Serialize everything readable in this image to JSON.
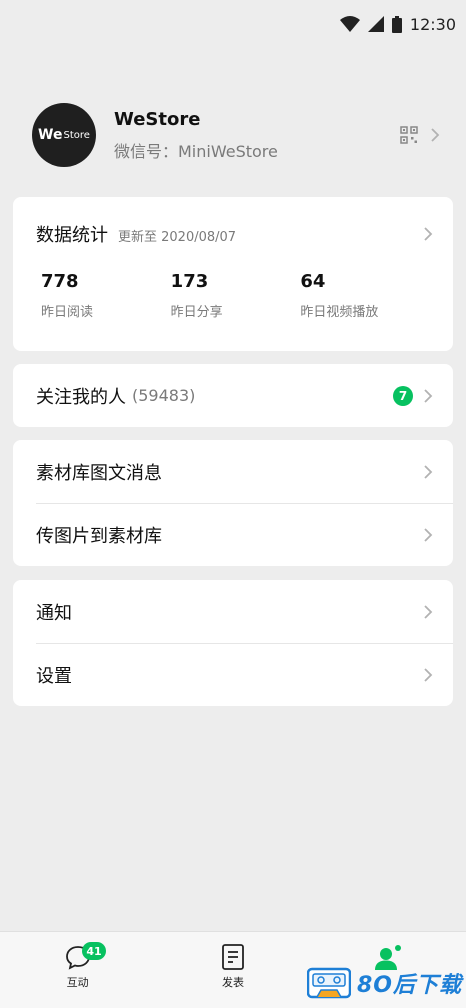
{
  "status_bar": {
    "time": "12:30"
  },
  "profile": {
    "avatar_text_we": "We",
    "avatar_text_store": "Store",
    "name": "WeStore",
    "wechat_id": "微信号：MiniWeStore"
  },
  "stats": {
    "title": "数据统计",
    "updated": "更新至 2020/08/07",
    "items": [
      {
        "value": "778",
        "label": "昨日阅读"
      },
      {
        "value": "173",
        "label": "昨日分享"
      },
      {
        "value": "64",
        "label": "昨日视频播放"
      }
    ]
  },
  "followers": {
    "label": "关注我的人",
    "count": "(59483)",
    "badge": "7"
  },
  "materials": {
    "items": [
      {
        "label": "素材库图文消息"
      },
      {
        "label": "传图片到素材库"
      }
    ]
  },
  "settings": {
    "items": [
      {
        "label": "通知"
      },
      {
        "label": "设置"
      }
    ]
  },
  "tabbar": {
    "tabs": [
      {
        "label": "互动",
        "badge": "41"
      },
      {
        "label": "发表"
      },
      {
        "label": "我"
      }
    ]
  },
  "watermark": {
    "text": "8O后下载"
  },
  "colors": {
    "accent": "#07c160",
    "background": "#ededed"
  }
}
